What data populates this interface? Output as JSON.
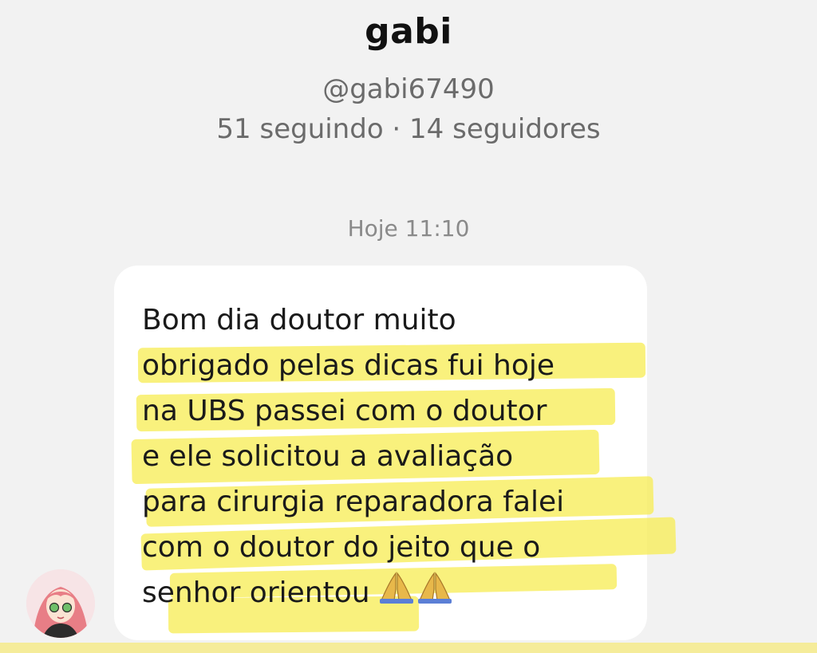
{
  "profile": {
    "display_name": "gabi",
    "username": "@gabi67490",
    "follow_stats": "51 seguindo · 14 seguidores"
  },
  "conversation": {
    "timestamp": "Hoje 11:10",
    "message": {
      "lines": [
        "Bom dia doutor muito",
        "obrigado pelas dicas fui hoje",
        "na UBS passei com o doutor",
        "e ele solicitou a avaliação",
        "para cirurgia reparadora falei",
        "com o doutor do jeito que o",
        "senhor orientou"
      ],
      "emoji": "folded-hands-icon x2",
      "highlight_color": "#f7ed58"
    },
    "sender_avatar": "anime-girl-avatar"
  }
}
